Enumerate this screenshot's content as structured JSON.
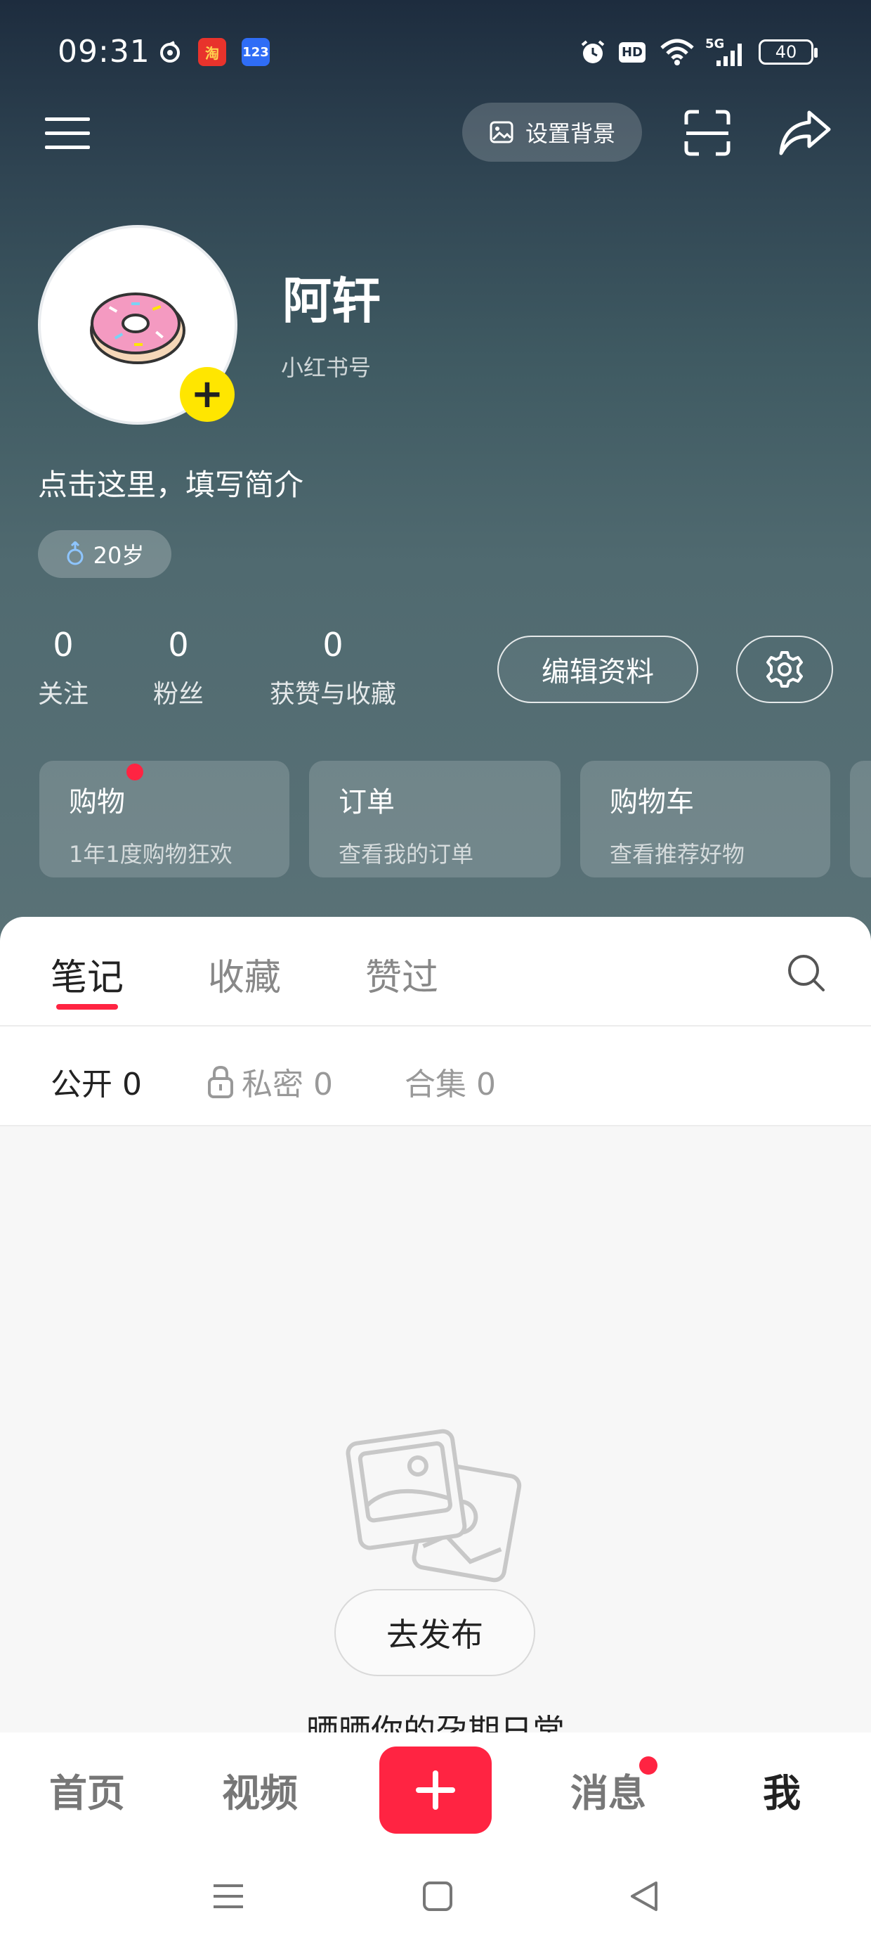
{
  "status_bar": {
    "time": "09:31",
    "app_icons": [
      "netease-music-icon",
      "taobao-icon",
      "123-app-icon"
    ],
    "taobao_label": "淘",
    "app_123_label": "123",
    "hd_label": "HD",
    "network_label": "5G",
    "battery": "40"
  },
  "toolbar": {
    "set_background": "设置背景"
  },
  "profile": {
    "name": "阿轩",
    "id_label": "小红书号",
    "bio": "点击这里，填写简介",
    "age_tag": "20岁",
    "stats": [
      {
        "value": "0",
        "label": "关注"
      },
      {
        "value": "0",
        "label": "粉丝"
      },
      {
        "value": "0",
        "label": "获赞与收藏"
      }
    ],
    "edit_button": "编辑资料"
  },
  "cards": [
    {
      "title": "购物",
      "subtitle": "1年1度购物狂欢"
    },
    {
      "title": "订单",
      "subtitle": "查看我的订单"
    },
    {
      "title": "购物车",
      "subtitle": "查看推荐好物"
    }
  ],
  "tabs": [
    {
      "label": "笔记",
      "active": true
    },
    {
      "label": "收藏",
      "active": false
    },
    {
      "label": "赞过",
      "active": false
    }
  ],
  "filters": [
    {
      "label": "公开 0",
      "active": true
    },
    {
      "label": "私密 0",
      "active": false
    },
    {
      "label": "合集 0",
      "active": false
    }
  ],
  "empty_state": {
    "message": "晒晒你的孕期日常",
    "button": "去发布"
  },
  "bottom_nav": [
    {
      "label": "首页"
    },
    {
      "label": "视频"
    },
    {
      "label": "消息"
    },
    {
      "label": "我"
    }
  ],
  "colors": {
    "accent": "#ff2442",
    "badge_yellow": "#ffe600"
  }
}
